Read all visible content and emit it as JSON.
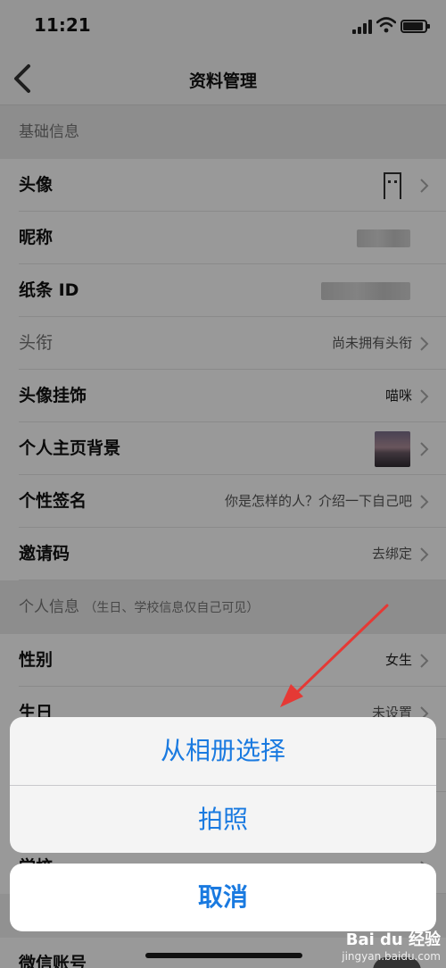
{
  "status": {
    "time": "11:21"
  },
  "nav": {
    "title": "资料管理"
  },
  "sections": {
    "basic": "基础信息",
    "personal": "个人信息",
    "personal_note": "（生日、学校信息仅自己可见）"
  },
  "rows": {
    "avatar": {
      "label": "头像"
    },
    "nickname": {
      "label": "昵称"
    },
    "note_id": {
      "label": "纸条 ID"
    },
    "title": {
      "label": "头衔",
      "value": "尚未拥有头衔"
    },
    "pendant": {
      "label": "头像挂饰",
      "value": "喵咪"
    },
    "background": {
      "label": "个人主页背景"
    },
    "signature": {
      "label": "个性签名",
      "value": "你是怎样的人？介绍一下自己吧"
    },
    "invite": {
      "label": "邀请码",
      "value": "去绑定"
    },
    "gender": {
      "label": "性别",
      "value": "女生"
    },
    "birthday": {
      "label": "生日",
      "value": "未设置"
    },
    "school": {
      "label": "学校"
    },
    "wechat": {
      "label": "微信账号"
    }
  },
  "action_sheet": {
    "option1": "从相册选择",
    "option2": "拍照",
    "cancel": "取消"
  },
  "watermark": {
    "brand": "Bai du 经验",
    "url": "jingyan.baidu.com"
  },
  "colors": {
    "accent": "#1a7ae0",
    "arrow": "#e53935"
  }
}
